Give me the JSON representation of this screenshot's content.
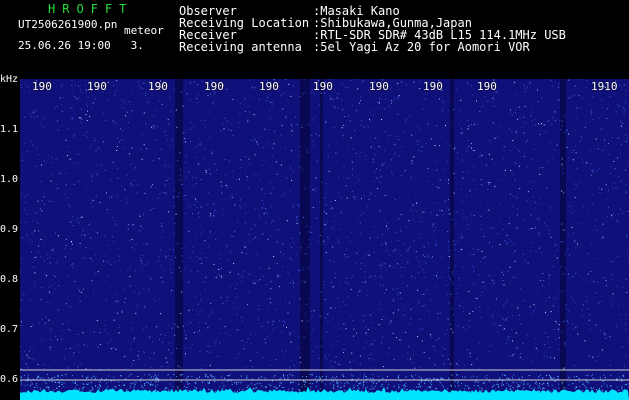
{
  "header": {
    "app_title": "HROFFT",
    "filename": "UT2506261900.pn",
    "mode": "meteor",
    "datetime": "25.06.26 19:00",
    "count": "3.",
    "observer_label": "Observer",
    "observer_value": ":Masaki Kano",
    "location_label": "Receiving Location",
    "location_value": ":Shibukawa,Gunma,Japan",
    "receiver_label": "Receiver",
    "receiver_value": ":RTL-SDR SDR# 43dB L15 114.1MHz USB",
    "antenna_label": "Receiving antenna",
    "antenna_value": ":5el Yagi Az 20 for Aomori VOR"
  },
  "axis": {
    "unit": "kHz",
    "y_ticks": [
      "1.1",
      "1.0",
      "0.9",
      "0.8",
      "0.7",
      "0.6"
    ],
    "time_ticks": [
      "190",
      "190",
      "190",
      "190",
      "190",
      "190",
      "190",
      "190",
      "190",
      "1910"
    ]
  },
  "colors": {
    "background": "#000000",
    "spectrogram_base": "#10107a",
    "noise_floor": "#00e5ff",
    "title_green": "#22dd33"
  }
}
